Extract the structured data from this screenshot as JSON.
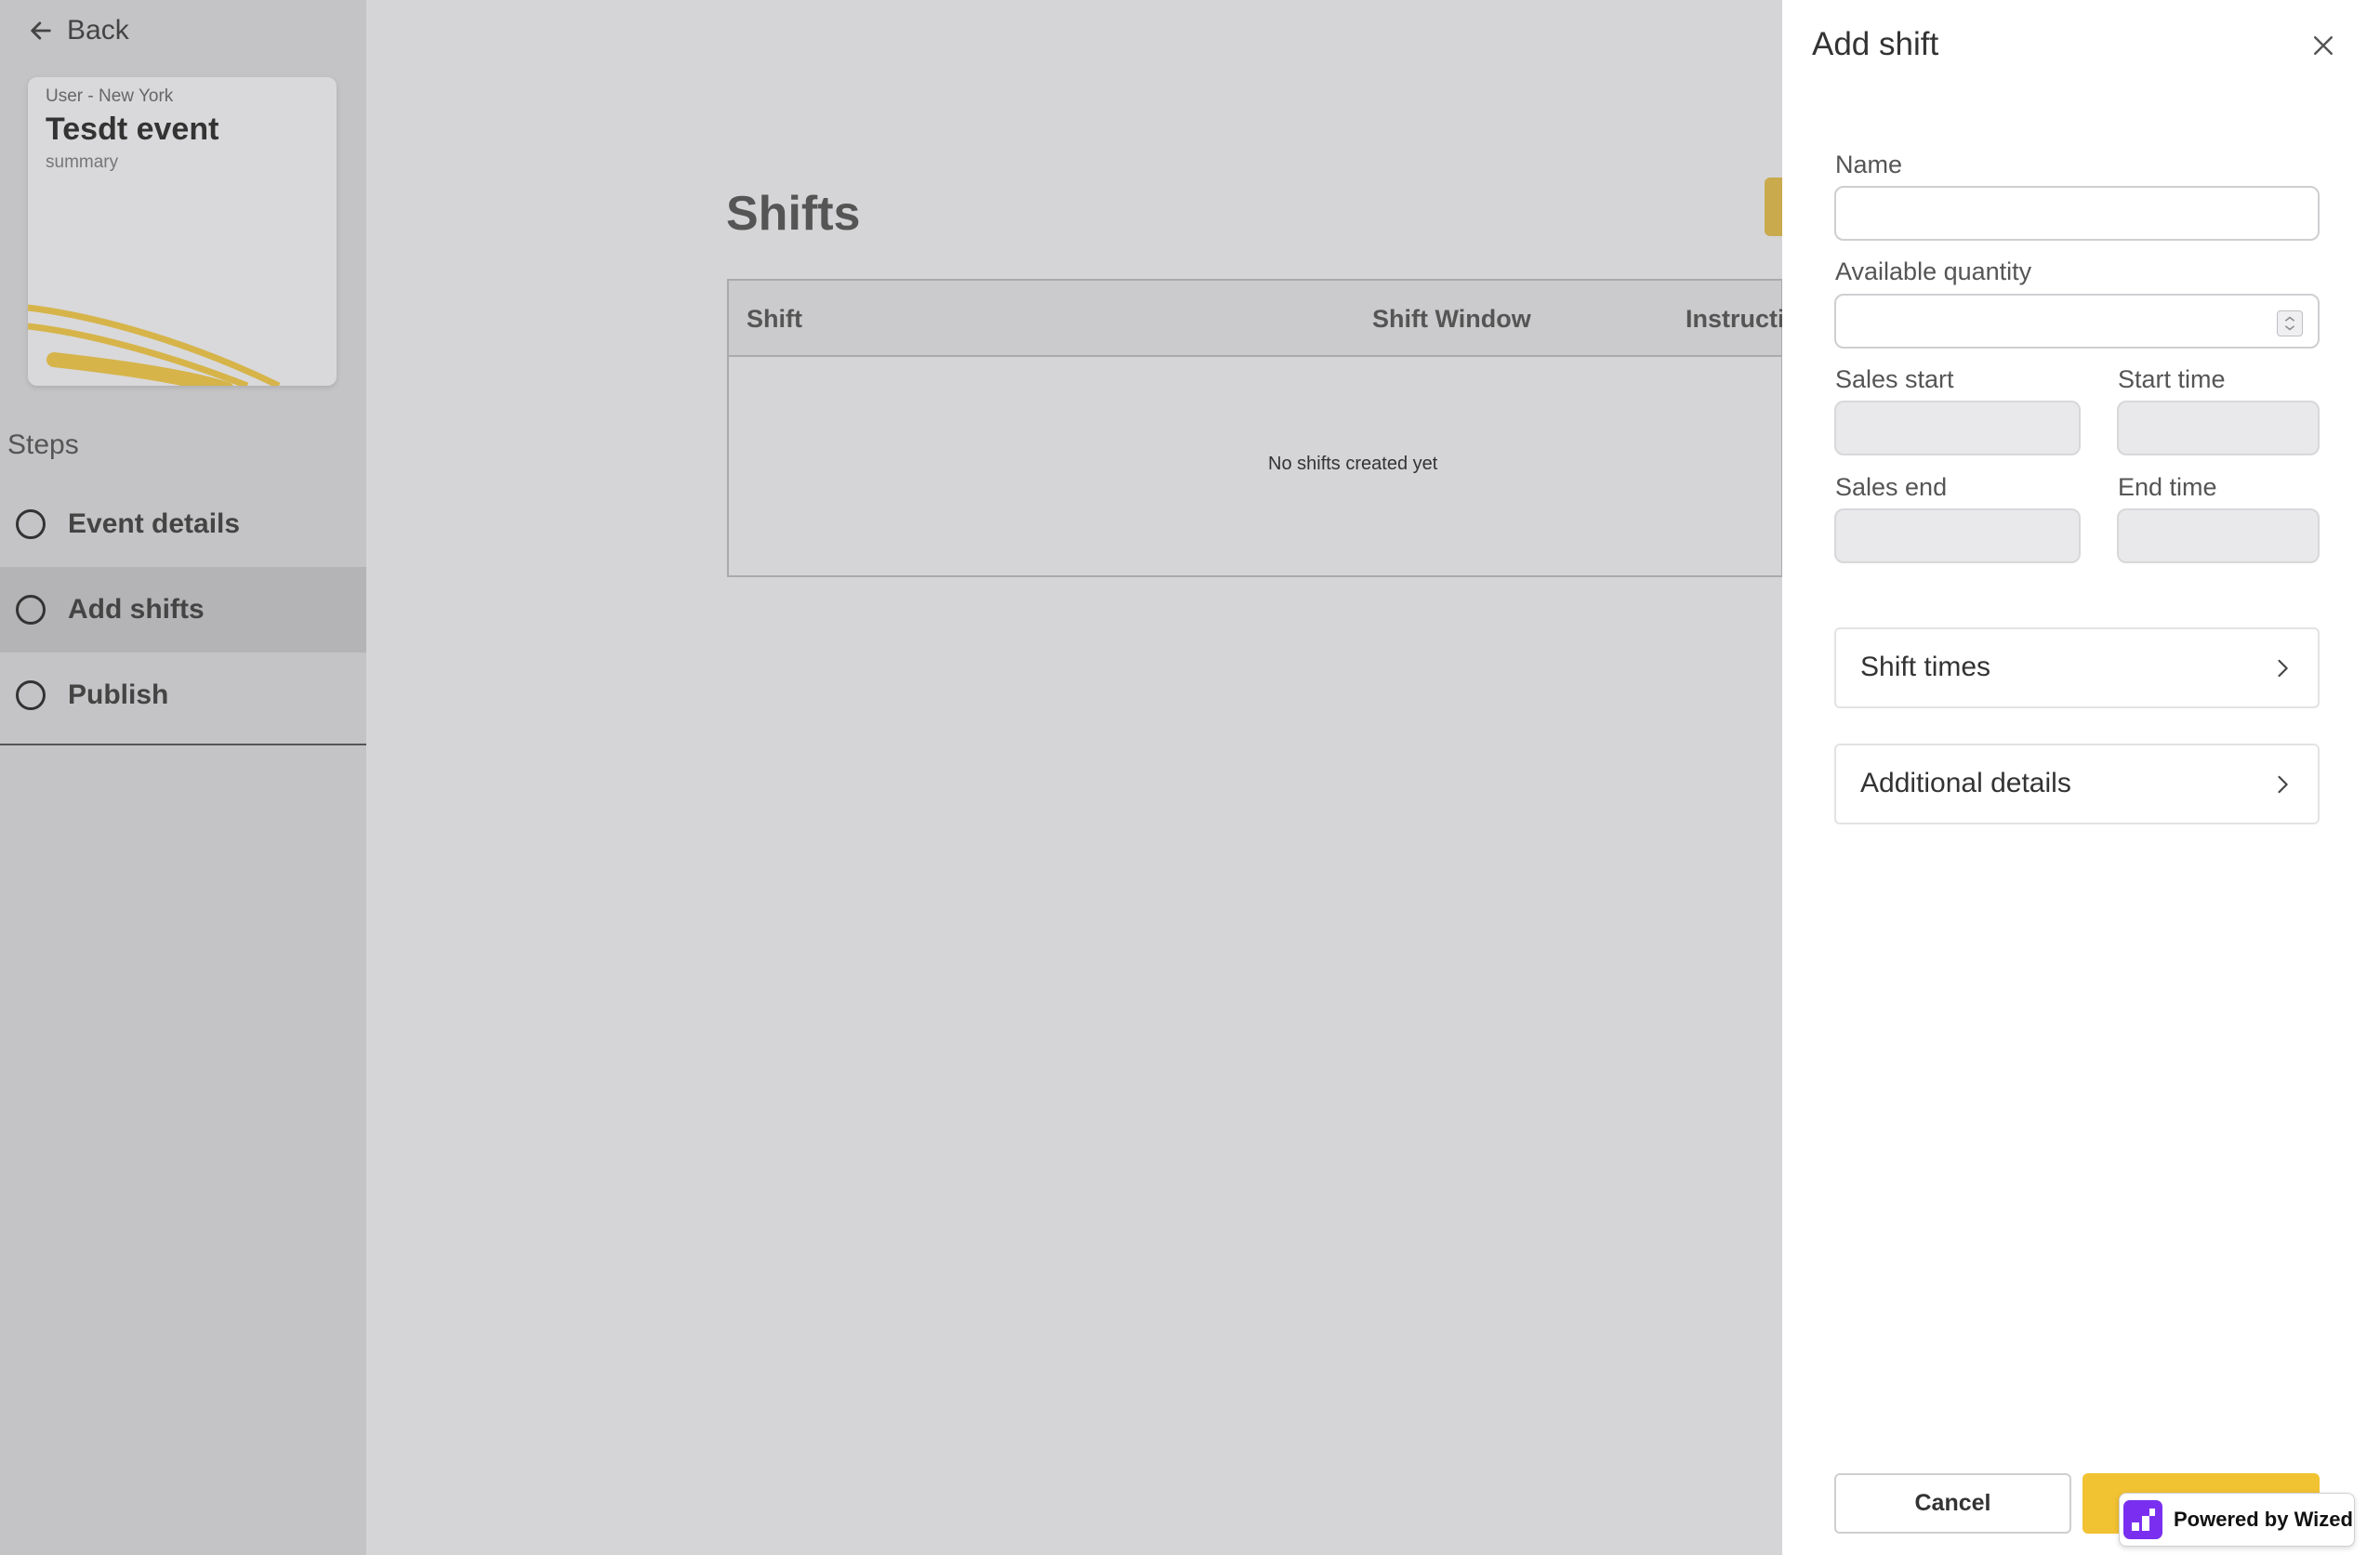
{
  "sidebar": {
    "back_label": "Back",
    "card": {
      "subtitle": "User - New York",
      "title": "Tesdt event",
      "summary": "summary"
    },
    "steps_label": "Steps",
    "steps": [
      {
        "label": "Event details"
      },
      {
        "label": "Add shifts"
      },
      {
        "label": "Publish"
      }
    ]
  },
  "main": {
    "title": "Shifts",
    "table": {
      "columns": [
        "Shift",
        "Shift Window",
        "Instructi"
      ],
      "empty_message": "No shifts created yet"
    }
  },
  "drawer": {
    "title": "Add shift",
    "fields": {
      "name_label": "Name",
      "name_value": "",
      "quantity_label": "Available quantity",
      "quantity_value": "",
      "sales_start_label": "Sales start",
      "start_time_label": "Start time",
      "sales_end_label": "Sales end",
      "end_time_label": "End time"
    },
    "accordions": [
      {
        "label": "Shift times"
      },
      {
        "label": "Additional details"
      }
    ],
    "cancel_label": "Cancel"
  },
  "badge": {
    "label": "Powered by Wized"
  },
  "colors": {
    "accent_yellow": "#f1c232",
    "wized_purple": "#7a2ff0",
    "overlay_grey": "#d5d5d7"
  }
}
